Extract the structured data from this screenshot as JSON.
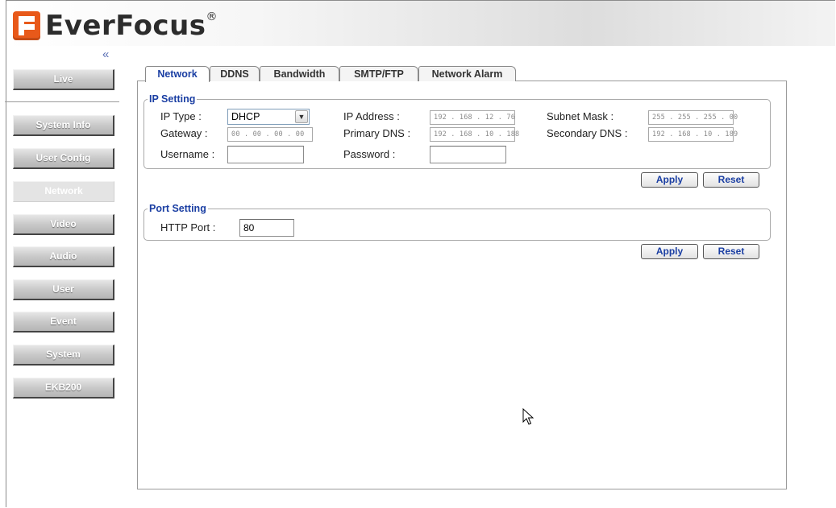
{
  "header": {
    "logo_text": "EverFocus",
    "logo_mark": "®"
  },
  "sidebar": {
    "collapse_glyph": "«",
    "items": [
      {
        "label": "Live",
        "active": false
      },
      {
        "label": "System Info",
        "active": false
      },
      {
        "label": "User Config",
        "active": false
      },
      {
        "label": "Network",
        "active": true
      },
      {
        "label": "Video",
        "active": false
      },
      {
        "label": "Audio",
        "active": false
      },
      {
        "label": "User",
        "active": false
      },
      {
        "label": "Event",
        "active": false
      },
      {
        "label": "System",
        "active": false
      },
      {
        "label": "EKB200",
        "active": false
      }
    ]
  },
  "tabs": [
    {
      "label": "Network",
      "active": true
    },
    {
      "label": "DDNS",
      "active": false
    },
    {
      "label": "Bandwidth",
      "active": false
    },
    {
      "label": "SMTP/FTP",
      "active": false
    },
    {
      "label": "Network Alarm",
      "active": false
    }
  ],
  "ip_setting": {
    "legend": "IP Setting",
    "ip_type_label": "IP Type :",
    "ip_type_value": "DHCP",
    "ip_address_label": "IP Address :",
    "ip_address_value": "192 . 168 . 12 . 76",
    "subnet_mask_label": "Subnet Mask :",
    "subnet_mask_value": "255 . 255 . 255 . 00",
    "gateway_label": "Gateway :",
    "gateway_value": "00 . 00 . 00 . 00",
    "primary_dns_label": "Primary DNS :",
    "primary_dns_value": "192 . 168 . 10 . 188",
    "secondary_dns_label": "Secondary DNS :",
    "secondary_dns_value": "192 . 168 . 10 . 189",
    "username_label": "Username :",
    "username_value": "",
    "password_label": "Password :",
    "password_value": "",
    "apply_label": "Apply",
    "reset_label": "Reset"
  },
  "port_setting": {
    "legend": "Port Setting",
    "http_port_label": "HTTP Port :",
    "http_port_value": "80",
    "apply_label": "Apply",
    "reset_label": "Reset"
  },
  "icons": {
    "select_arrow": "chevron-down-icon",
    "cursor": "mouse-pointer-icon"
  }
}
